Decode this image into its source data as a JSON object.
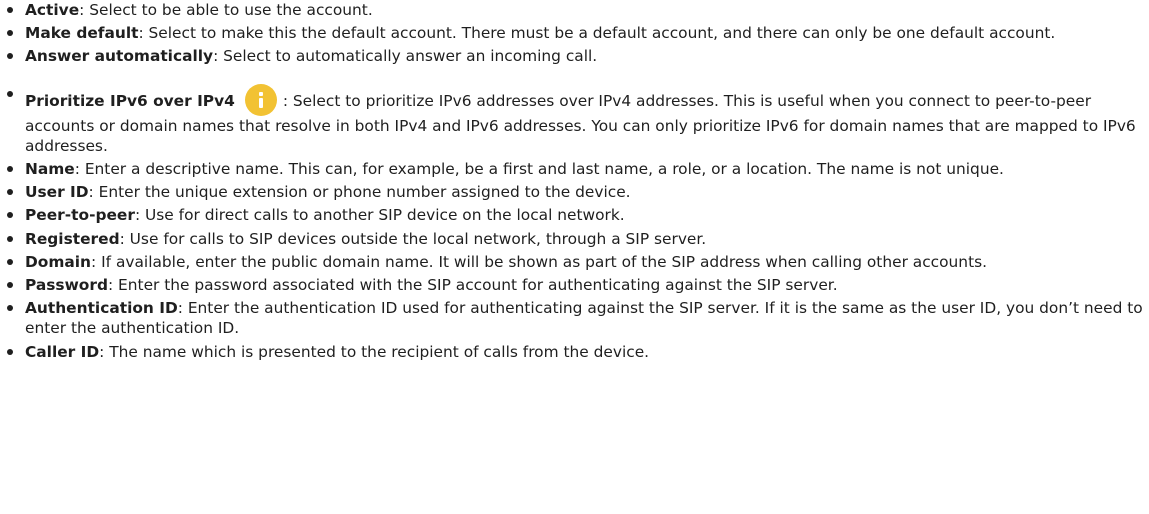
{
  "items": [
    {
      "term": "Active",
      "desc": ": Select to be able to use the account."
    },
    {
      "term": "Make default",
      "desc": ": Select to make this the default account. There must be a default account, and there can only be one default account."
    },
    {
      "term": "Answer automatically",
      "desc": ": Select to automatically answer an incoming call."
    },
    {
      "term": "Prioritize IPv6 over IPv4",
      "icon": "info-icon",
      "desc": ": Select to prioritize IPv6 addresses over IPv4 addresses. This is useful when you connect to peer-to-peer accounts or domain names that resolve in both IPv4 and IPv6 addresses. You can only prioritize IPv6 for domain names that are mapped to IPv6 addresses."
    },
    {
      "term": "Name",
      "desc": ": Enter a descriptive name. This can, for example, be a first and last name, a role, or a location. The name is not unique."
    },
    {
      "term": "User ID",
      "desc": ": Enter the unique extension or phone number assigned to the device."
    },
    {
      "term": "Peer-to-peer",
      "desc": ": Use for direct calls to another SIP device on the local network."
    },
    {
      "term": "Registered",
      "desc": ": Use for calls to SIP devices outside the local network, through a SIP server."
    },
    {
      "term": "Domain",
      "desc": ": If available, enter the public domain name. It will be shown as part of the SIP address when calling other accounts."
    },
    {
      "term": "Password",
      "desc": ": Enter the password associated with the SIP account for authenticating against the SIP server."
    },
    {
      "term": "Authentication ID",
      "desc": ": Enter the authentication ID used for authenticating against the SIP server. If it is the same as the user ID, you don’t need to enter the authentication ID."
    },
    {
      "term": "Caller ID",
      "desc": ": The name which is presented to the recipient of calls from the device."
    }
  ],
  "colors": {
    "text": "#1f1f1f",
    "info_icon": "#f2c233"
  }
}
